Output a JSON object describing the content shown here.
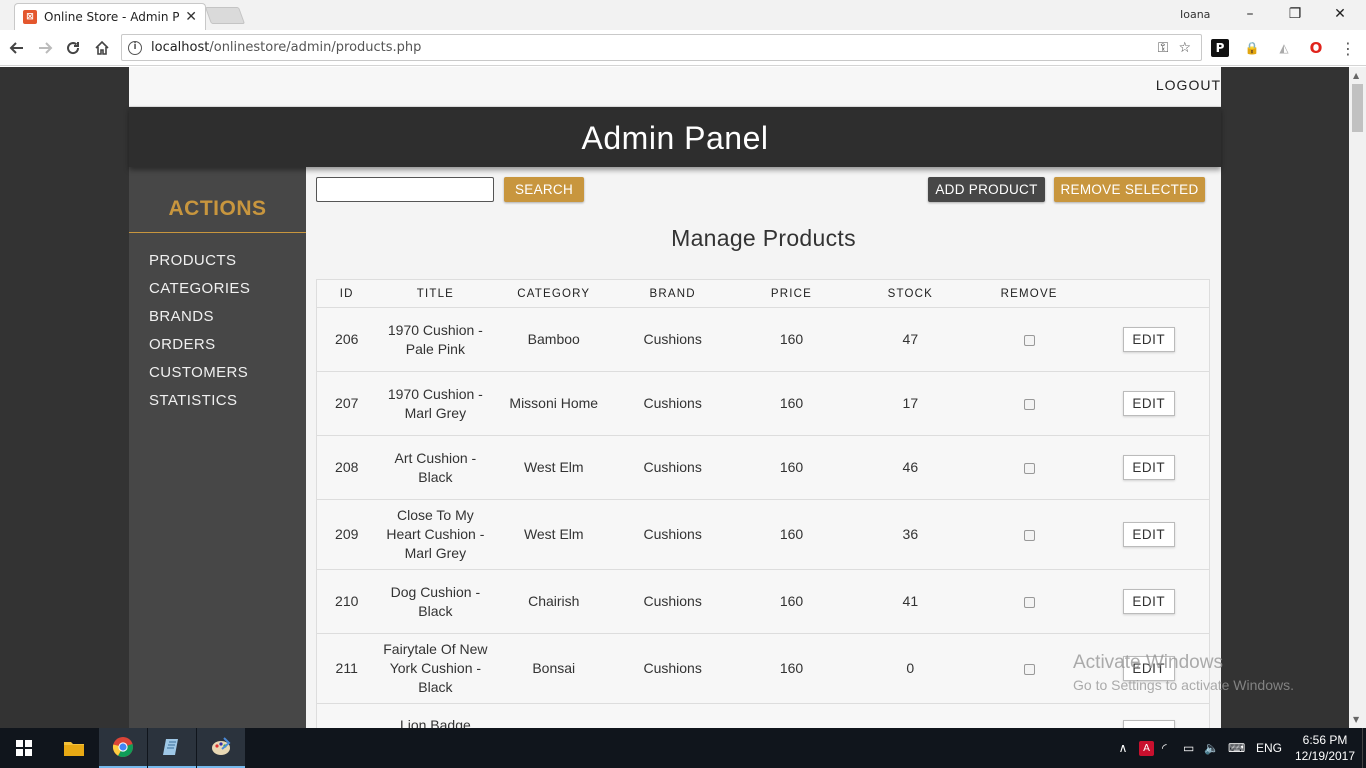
{
  "browser": {
    "tab_title": "Online Store - Admin Par",
    "tab_favicon": "xampp-icon",
    "user": "Ioana",
    "url_host": "localhost",
    "url_path": "/onlinestore/admin/products.php"
  },
  "window_controls": {
    "minimize": "–",
    "restore": "❐",
    "close": "✕"
  },
  "topbar": {
    "logout": "LOGOUT"
  },
  "header": {
    "title": "Admin Panel"
  },
  "sidebar": {
    "title": "ACTIONS",
    "items": [
      {
        "label": "PRODUCTS"
      },
      {
        "label": "CATEGORIES"
      },
      {
        "label": "BRANDS"
      },
      {
        "label": "ORDERS"
      },
      {
        "label": "CUSTOMERS"
      },
      {
        "label": "STATISTICS"
      }
    ]
  },
  "toolbar": {
    "search_placeholder": "",
    "search_label": "SEARCH",
    "add_label": "ADD PRODUCT",
    "remove_label": "REMOVE SELECTED"
  },
  "main": {
    "heading": "Manage Products"
  },
  "table": {
    "headers": [
      "ID",
      "TITLE",
      "CATEGORY",
      "BRAND",
      "PRICE",
      "STOCK",
      "REMOVE"
    ],
    "edit_label": "EDIT",
    "rows": [
      {
        "id": "206",
        "title": "1970 Cushion - Pale Pink",
        "category": "Bamboo",
        "brand": "Cushions",
        "price": "160",
        "stock": "47"
      },
      {
        "id": "207",
        "title": "1970 Cushion - Marl Grey",
        "category": "Missoni Home",
        "brand": "Cushions",
        "price": "160",
        "stock": "17"
      },
      {
        "id": "208",
        "title": "Art Cushion - Black",
        "category": "West Elm",
        "brand": "Cushions",
        "price": "160",
        "stock": "46"
      },
      {
        "id": "209",
        "title": "Close To My Heart Cushion - Marl Grey",
        "category": "West Elm",
        "brand": "Cushions",
        "price": "160",
        "stock": "36"
      },
      {
        "id": "210",
        "title": "Dog Cushion - Black",
        "category": "Chairish",
        "brand": "Cushions",
        "price": "160",
        "stock": "41"
      },
      {
        "id": "211",
        "title": "Fairytale Of New York Cushion - Black",
        "category": "Bonsai",
        "brand": "Cushions",
        "price": "160",
        "stock": "0"
      },
      {
        "id": "",
        "title": "Lion Badge",
        "category": "",
        "brand": "",
        "price": "",
        "stock": ""
      }
    ]
  },
  "watermark": {
    "line1": "Activate Windows",
    "line2": "Go to Settings to activate Windows."
  },
  "taskbar": {
    "language": "ENG",
    "time": "6:56 PM",
    "date": "12/19/2017"
  },
  "colors": {
    "accent_gold": "#c8963e",
    "header_dark": "#2e2e2e",
    "sidebar": "#474747",
    "page_bg": "#333333"
  }
}
